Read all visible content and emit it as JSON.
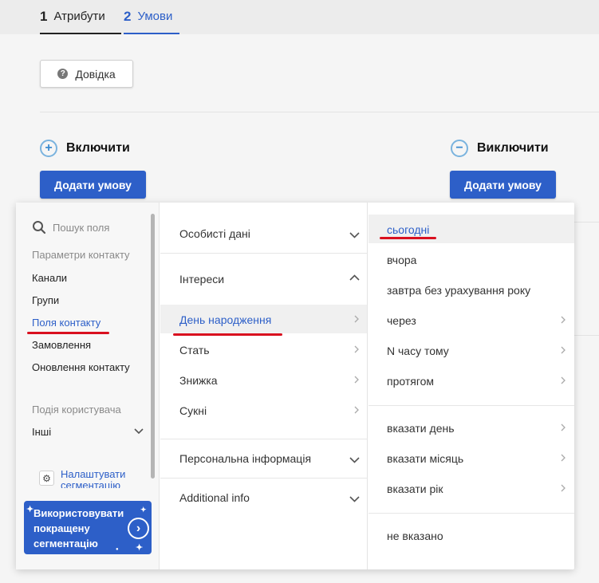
{
  "tabs": [
    {
      "num": "1",
      "label": "Атрибути"
    },
    {
      "num": "2",
      "label": "Умови"
    }
  ],
  "help_button": {
    "icon": "?",
    "label": "Довідка"
  },
  "include": {
    "icon": "+",
    "title": "Включити",
    "button": "Додати умову"
  },
  "exclude": {
    "icon": "−",
    "title": "Виключити",
    "button": "Додати умову"
  },
  "field_menu": {
    "search_placeholder": "Пошук поля",
    "group1_title": "Параметри контакту",
    "group1_items": [
      "Канали",
      "Групи",
      "Поля контакту",
      "Замовлення",
      "Оновлення контакту"
    ],
    "group2_title": "Подія користувача",
    "group2_items": [
      "Інші"
    ],
    "settings_link": "Налаштувати сегментацію",
    "promo_text": "Використовувати покращену сегментацію"
  },
  "category_menu": {
    "sections": [
      "Особисті дані",
      "Інтереси",
      "Персональна інформація",
      "Additional info"
    ],
    "interest_items": [
      "День народження",
      "Стать",
      "Знижка",
      "Сукні"
    ]
  },
  "value_menu": {
    "group1": [
      "сьогодні",
      "вчора",
      "завтра без урахування року",
      "через",
      "N часу тому",
      "протягом"
    ],
    "group2": [
      "вказати день",
      "вказати місяць",
      "вказати рік"
    ],
    "group3": [
      "не вказано"
    ]
  },
  "colors": {
    "accent": "#2d5fc8",
    "underline": "#d9101f"
  }
}
